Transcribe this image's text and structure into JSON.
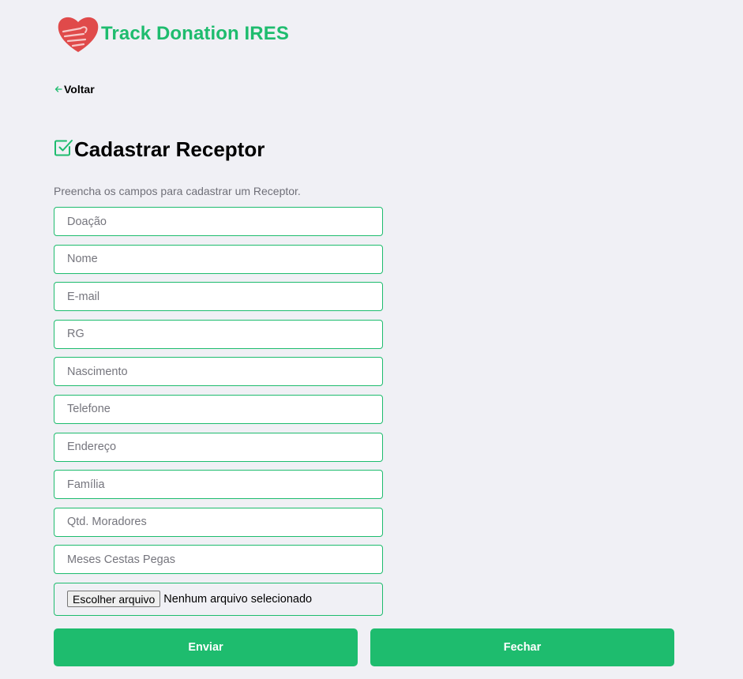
{
  "header": {
    "logo_icon": "heart-hand-icon",
    "title": "Track Donation IRES"
  },
  "nav": {
    "back_label": "Voltar",
    "back_icon": "arrow-left-icon"
  },
  "page": {
    "title_icon": "checkbox-icon",
    "title": "Cadastrar Receptor",
    "subtitle": "Preencha os campos para cadastrar um Receptor."
  },
  "form": {
    "fields": [
      {
        "placeholder": "Doação",
        "value": ""
      },
      {
        "placeholder": "Nome",
        "value": ""
      },
      {
        "placeholder": "E-mail",
        "value": ""
      },
      {
        "placeholder": "RG",
        "value": ""
      },
      {
        "placeholder": "Nascimento",
        "value": ""
      },
      {
        "placeholder": "Telefone",
        "value": ""
      },
      {
        "placeholder": "Endereço",
        "value": ""
      },
      {
        "placeholder": "Família",
        "value": ""
      },
      {
        "placeholder": "Qtd. Moradores",
        "value": ""
      },
      {
        "placeholder": "Meses Cestas Pegas",
        "value": ""
      }
    ],
    "file": {
      "button_label": "Escolher arquivo",
      "status": "Nenhum arquivo selecionado"
    }
  },
  "actions": {
    "submit_label": "Enviar",
    "close_label": "Fechar"
  },
  "colors": {
    "accent": "#1ebc6e",
    "logo_red": "#e04a4a",
    "background": "#f0f0f5",
    "subtitle_text": "#6f6f78"
  }
}
